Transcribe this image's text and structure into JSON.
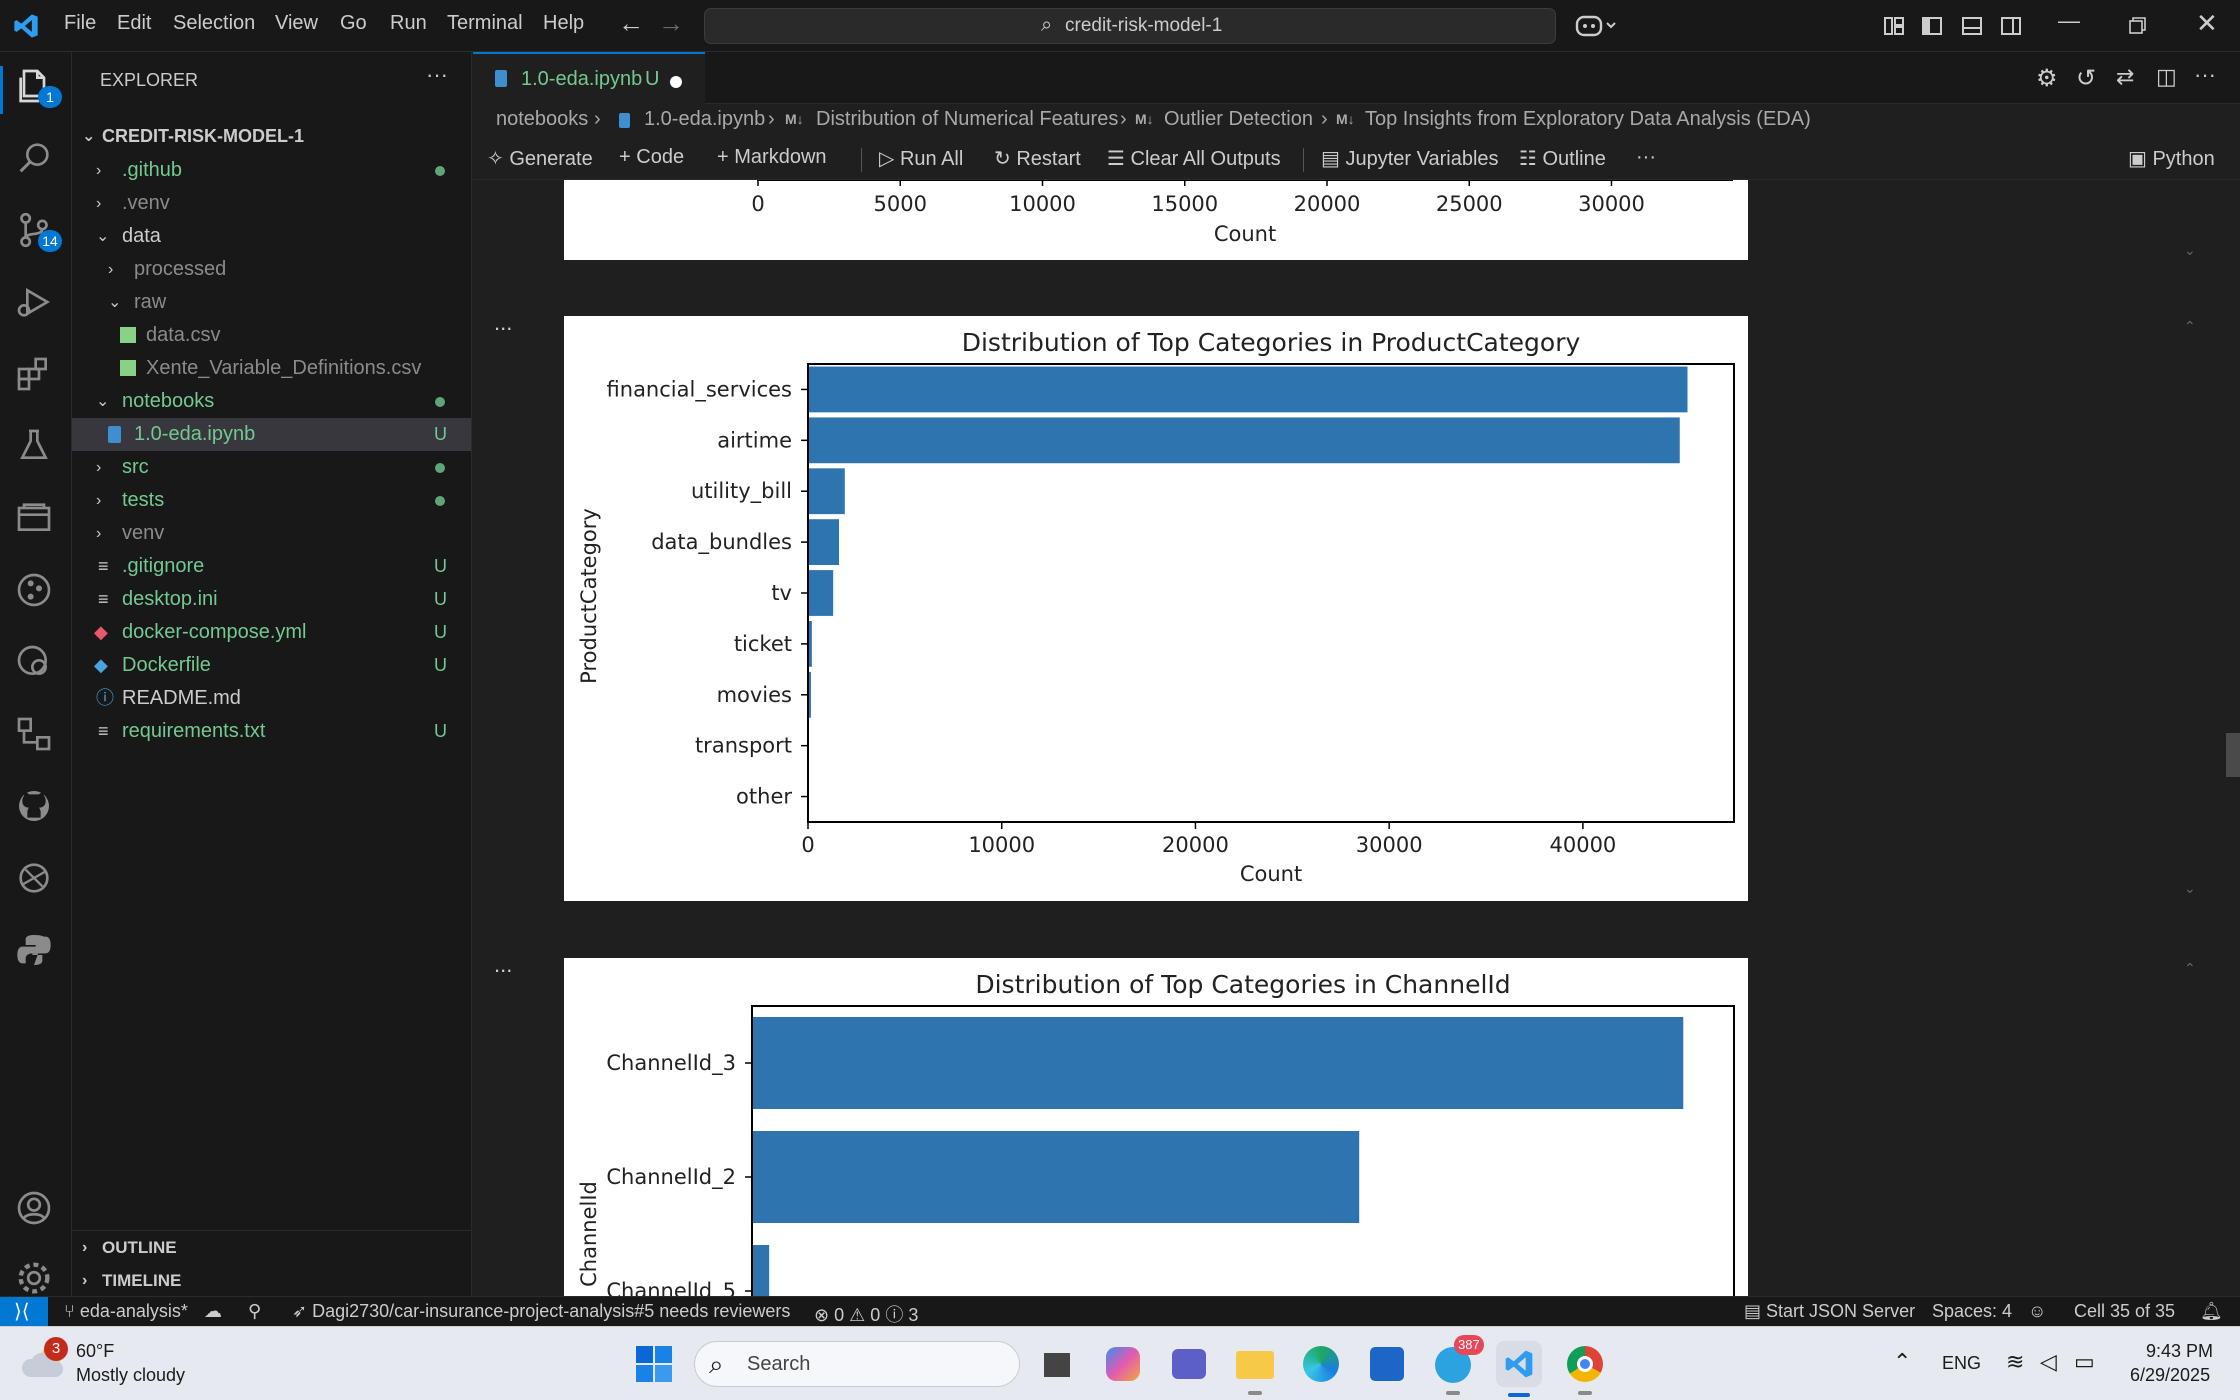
{
  "menu": [
    "File",
    "Edit",
    "Selection",
    "View",
    "Go",
    "Run",
    "Terminal",
    "Help"
  ],
  "command_center": "credit-risk-model-1",
  "activity_badges": {
    "explorer": "1",
    "scm": "14"
  },
  "explorer": {
    "title": "EXPLORER",
    "root": "CREDIT-RISK-MODEL-1",
    "items": [
      {
        "label": ".github",
        "status": ""
      },
      {
        "label": ".venv",
        "status": ""
      },
      {
        "label": "data",
        "status": ""
      },
      {
        "label": "processed",
        "status": ""
      },
      {
        "label": "raw",
        "status": ""
      },
      {
        "label": "data.csv",
        "status": ""
      },
      {
        "label": "Xente_Variable_Definitions.csv",
        "status": ""
      },
      {
        "label": "notebooks",
        "status": ""
      },
      {
        "label": "1.0-eda.ipynb",
        "status": "U"
      },
      {
        "label": "src",
        "status": ""
      },
      {
        "label": "tests",
        "status": ""
      },
      {
        "label": "venv",
        "status": ""
      },
      {
        "label": ".gitignore",
        "status": "U"
      },
      {
        "label": "desktop.ini",
        "status": "U"
      },
      {
        "label": "docker-compose.yml",
        "status": "U"
      },
      {
        "label": "Dockerfile",
        "status": "U"
      },
      {
        "label": "README.md",
        "status": ""
      },
      {
        "label": "requirements.txt",
        "status": "U"
      }
    ],
    "outline": "OUTLINE",
    "timeline": "TIMELINE"
  },
  "tab": {
    "label": "1.0-eda.ipynb",
    "status": "U"
  },
  "breadcrumb": [
    "notebooks",
    "1.0-eda.ipynb",
    "Distribution of Numerical Features",
    "Outlier Detection",
    "Top Insights from Exploratory Data Analysis (EDA)"
  ],
  "md_prefix": "M↓",
  "toolbar": {
    "generate": "Generate",
    "code": "Code",
    "markdown": "Markdown",
    "run_all": "Run All",
    "restart": "Restart",
    "clear": "Clear All Outputs",
    "variables": "Jupyter Variables",
    "outline": "Outline",
    "more": "···",
    "kernel": "Python"
  },
  "cell_more": "...",
  "chart_data": [
    {
      "type": "bar",
      "orientation": "horizontal",
      "partial": "bottom-axis-only",
      "xlabel": "Count",
      "xticks": [
        0,
        5000,
        10000,
        15000,
        20000,
        25000,
        30000
      ]
    },
    {
      "type": "bar",
      "orientation": "horizontal",
      "title": "Distribution of Top Categories in ProductCategory",
      "categories": [
        "financial_services",
        "airtime",
        "utility_bill",
        "data_bundles",
        "tv",
        "ticket",
        "movies",
        "transport",
        "other"
      ],
      "values": [
        45400,
        45000,
        1900,
        1600,
        1300,
        200,
        150,
        20,
        10
      ],
      "xlabel": "Count",
      "ylabel": "ProductCategory",
      "xticks": [
        0,
        10000,
        20000,
        30000,
        40000
      ],
      "xlim": [
        0,
        47800
      ],
      "color": "#2e75b0"
    },
    {
      "type": "bar",
      "orientation": "horizontal",
      "title": "Distribution of Top Categories in ChannelId",
      "categories": [
        "ChannelId_3",
        "ChannelId_2",
        "ChannelId_5"
      ],
      "values": [
        56900,
        37100,
        1050
      ],
      "ylabel": "ChannelId",
      "xlim": [
        0,
        60000
      ],
      "color": "#2e75b0"
    }
  ],
  "status": {
    "branch": "eda-analysis*",
    "pr": "Dagi2730/car-insurance-project-analysis#5 needs reviewers",
    "errors": "0",
    "warnings": "0",
    "infos": "3",
    "json": "Start JSON Server",
    "spaces": "Spaces: 4",
    "cell": "Cell 35 of 35"
  },
  "taskbar": {
    "weather_temp": "60°F",
    "weather_desc": "Mostly cloudy",
    "weather_badge": "3",
    "search": "Search",
    "telegram_badge": "387",
    "lang": "ENG",
    "time": "9:43 PM",
    "date": "6/29/2025"
  }
}
